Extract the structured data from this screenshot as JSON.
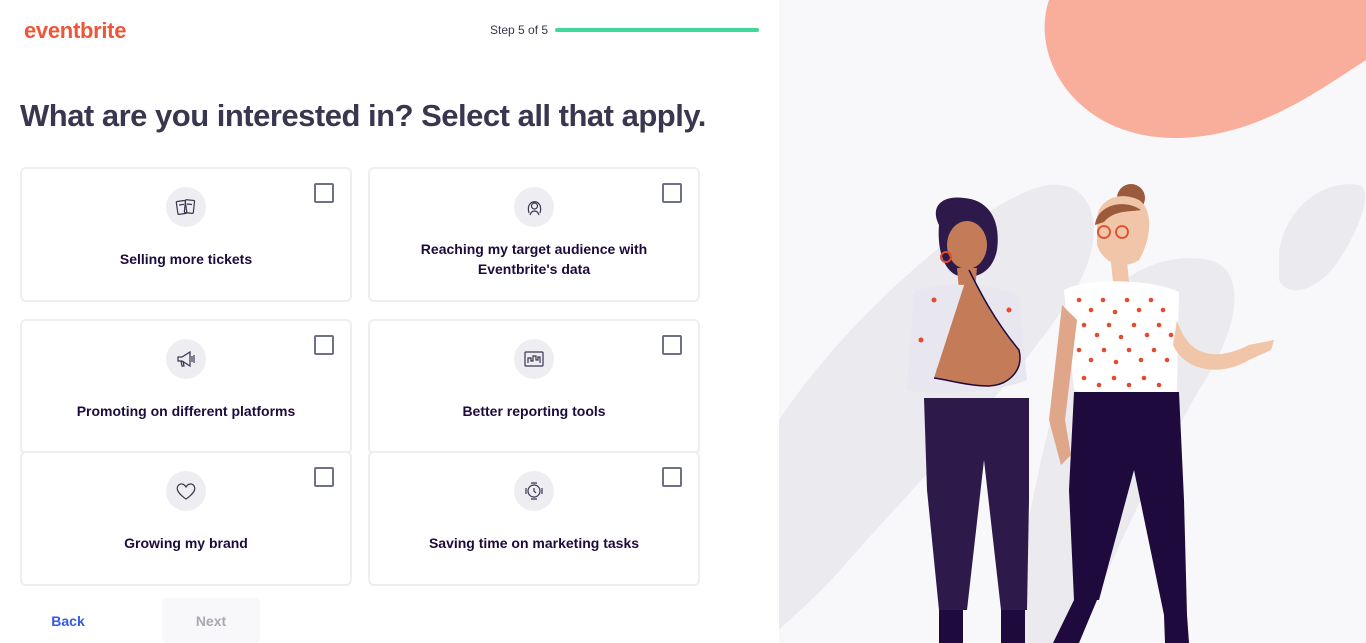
{
  "brand": {
    "logo_text": "eventbrite",
    "accent": "#f05537"
  },
  "progress": {
    "label": "Step 5 of 5",
    "fraction": 1.0,
    "color": "#3fd89b"
  },
  "title": "What are you interested in? Select all that apply.",
  "options": [
    {
      "label": "Selling more tickets",
      "icon": "tickets-icon",
      "checked": false
    },
    {
      "label": "Reaching my target audience with Eventbrite's data",
      "icon": "audience-icon",
      "checked": false
    },
    {
      "label": "Promoting on different platforms",
      "icon": "megaphone-icon",
      "checked": false
    },
    {
      "label": "Better reporting tools",
      "icon": "chart-icon",
      "checked": false
    },
    {
      "label": "Growing my brand",
      "icon": "heart-icon",
      "checked": false
    },
    {
      "label": "Saving time on marketing tasks",
      "icon": "clock-icon",
      "checked": false
    }
  ],
  "nav": {
    "back_label": "Back",
    "next_label": "Next"
  }
}
